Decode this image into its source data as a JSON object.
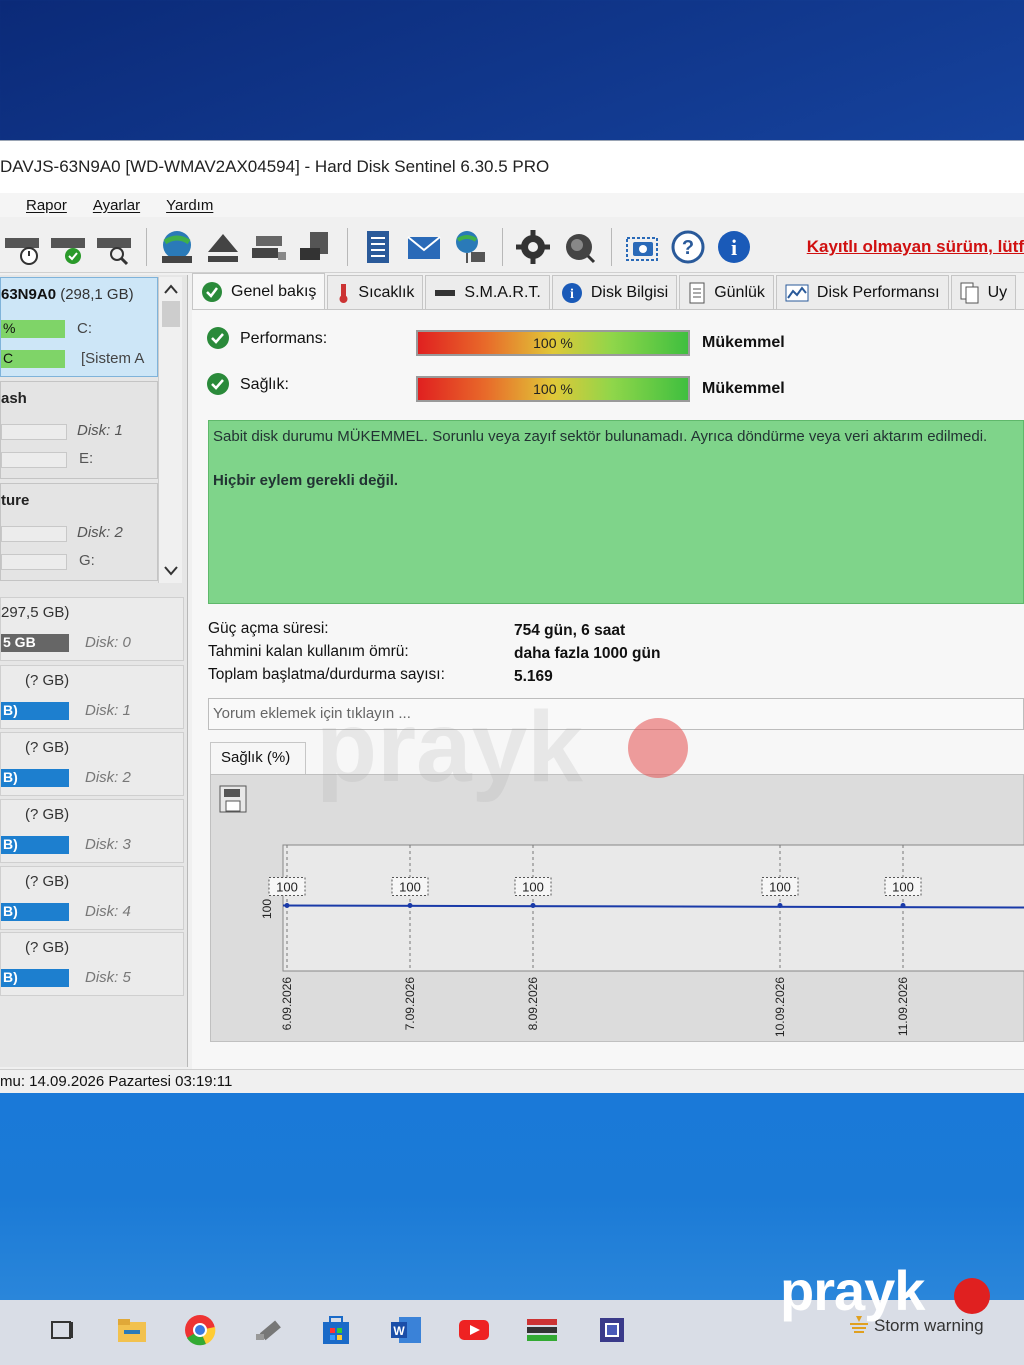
{
  "window": {
    "title": "DAVJS-63N9A0 [WD-WMAV2AX04594]  -  Hard Disk Sentinel 6.30.5 PRO",
    "menu": [
      "Rapor",
      "Ayarlar",
      "Yardım"
    ],
    "unregistered_notice": "Kayıtlı olmayan sürüm, lütf"
  },
  "toolbar": {
    "icons": [
      "disk-time-icon",
      "disk-check-icon",
      "disk-search-icon",
      "globe-disk-icon",
      "eject-icon",
      "network-disk-icon",
      "usb-disk-icon",
      "report-icon",
      "mail-icon",
      "network-icon",
      "settings-icon",
      "sound-icon",
      "screenshot-icon",
      "help-icon",
      "info-icon"
    ]
  },
  "left_panel": {
    "selected_disk": {
      "name": "63N9A0",
      "size": "(298,1 GB)",
      "row1_pct": "%",
      "row1_drive": "C:",
      "row2_pct": "C",
      "row2_drive": "[Sistem A"
    },
    "groups": [
      {
        "title": "ash",
        "disk": "Disk: 1",
        "drive": "E:"
      },
      {
        "title": "ture",
        "disk": "Disk: 2",
        "drive": "G:"
      }
    ],
    "disk_cards": [
      {
        "size": "297,5 GB)",
        "bar": "5 GB",
        "disk": "Disk: 0"
      },
      {
        "size": "(? GB)",
        "bar": "B)",
        "disk": "Disk: 1"
      },
      {
        "size": "(? GB)",
        "bar": "B)",
        "disk": "Disk: 2"
      },
      {
        "size": "(? GB)",
        "bar": "B)",
        "disk": "Disk: 3"
      },
      {
        "size": "(? GB)",
        "bar": "B)",
        "disk": "Disk: 4"
      },
      {
        "size": "(? GB)",
        "bar": "B)",
        "disk": "Disk: 5"
      }
    ]
  },
  "tabs": [
    {
      "label": "Genel bakış",
      "icon": "check-icon"
    },
    {
      "label": "Sıcaklık",
      "icon": "thermometer-icon"
    },
    {
      "label": "S.M.A.R.T.",
      "icon": "smart-icon"
    },
    {
      "label": "Disk Bilgisi",
      "icon": "info-icon"
    },
    {
      "label": "Günlük",
      "icon": "log-icon"
    },
    {
      "label": "Disk Performansı",
      "icon": "performance-icon"
    },
    {
      "label": "Uy",
      "icon": "copy-icon"
    }
  ],
  "overview": {
    "performance_label": "Performans:",
    "performance_value": "100 %",
    "performance_level": 1.0,
    "performance_status": "Mükemmel",
    "health_label": "Sağlık:",
    "health_value": "100 %",
    "health_level": 1.0,
    "health_status": "Mükemmel",
    "status_message": "Sabit disk durumu MÜKEMMEL. Sorunlu veya zayıf sektör bulunamadı. Ayrıca döndürme veya veri aktarım edilmedi.",
    "action": "Hiçbir eylem gerekli değil.",
    "info": [
      {
        "label": "Güç açma süresi:",
        "value": "754 gün, 6 saat"
      },
      {
        "label": "Tahmini kalan kullanım ömrü:",
        "value": "daha fazla 1000 gün"
      },
      {
        "label": "Toplam başlatma/durdurma sayısı:",
        "value": "5.169"
      }
    ],
    "comment_placeholder": "Yorum eklemek için tıklayın ..."
  },
  "chart_tab": "Sağlık (%)",
  "chart_data": {
    "type": "line",
    "x": [
      "6.09.2026",
      "7.09.2026",
      "8.09.2026",
      "10.09.2026",
      "11.09.2026"
    ],
    "values": [
      100,
      100,
      100,
      100,
      100
    ],
    "ylabel": "100"
  },
  "statusbar": "mu: 14.09.2026 Pazartesi 03:19:11",
  "taskbar": {
    "weather": "Storm warning",
    "apps": [
      "task-view-icon",
      "file-explorer-icon",
      "chrome-icon",
      "usb-icon",
      "store-icon",
      "word-icon",
      "youtube-icon",
      "hdsentinel-icon",
      "cpu-icon"
    ]
  },
  "watermark": "prayk",
  "colors": {
    "accent_blue": "#1d7fcf",
    "status_green": "#7fd48a",
    "unregistered_red": "#d01010"
  }
}
